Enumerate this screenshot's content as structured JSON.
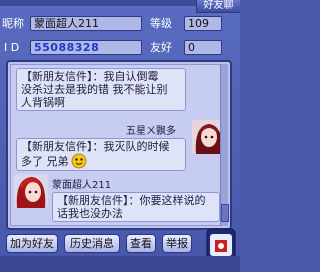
{
  "window": {
    "title_tab": "好友聊"
  },
  "profile": {
    "nickname_label": "昵称",
    "nickname_value": "蒙面超人211",
    "level_label": "等级",
    "level_value": "109",
    "id_label": "I D",
    "id_value": "55088328",
    "friend_label": "友好",
    "friend_value": "0"
  },
  "chat": {
    "messages": [
      {
        "text_line1": "【新朋友信件】：我自认倒霉",
        "text_line2": "没杀过去是我的错 我不能让别",
        "text_line3": "人背锅啊"
      },
      {
        "sender": "五星ㄨ飘多"
      },
      {
        "text_line1": "【新朋友信件】：我灭队的时候",
        "text_line2": "多了 兄弟"
      },
      {
        "sender": "蒙面超人211"
      },
      {
        "text_line1": "【新朋友信件】：你要这样说的",
        "text_line2": "话我也没办法"
      }
    ]
  },
  "buttons": {
    "add_friend": "加为好友",
    "history": "历史消息",
    "view": "查看",
    "report": "举报"
  },
  "colors": {
    "panel": "#bdc3ec",
    "frame": "#4a5aa8",
    "accent_red": "#c8201c"
  }
}
